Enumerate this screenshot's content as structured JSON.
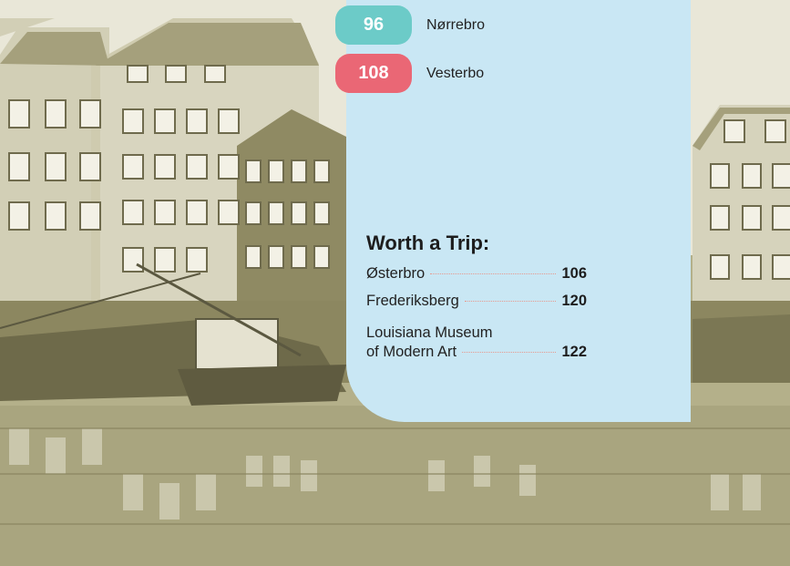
{
  "neighbourhoods": [
    {
      "page": "96",
      "name": "Nørrebro",
      "color": "#6ccbc8"
    },
    {
      "page": "108",
      "name": "Vesterbo",
      "color": "#ea6775"
    }
  ],
  "worth_a_trip": {
    "title": "Worth a Trip:",
    "items": [
      {
        "name": "Østerbro",
        "page": "106"
      },
      {
        "name": "Frederiksberg",
        "page": "120"
      },
      {
        "name_line1": "Louisiana Museum",
        "name_line2": "of Modern Art",
        "page": "122"
      }
    ]
  },
  "colors": {
    "panel": "#c9e7f4",
    "photo_tint": "#a7a379"
  }
}
